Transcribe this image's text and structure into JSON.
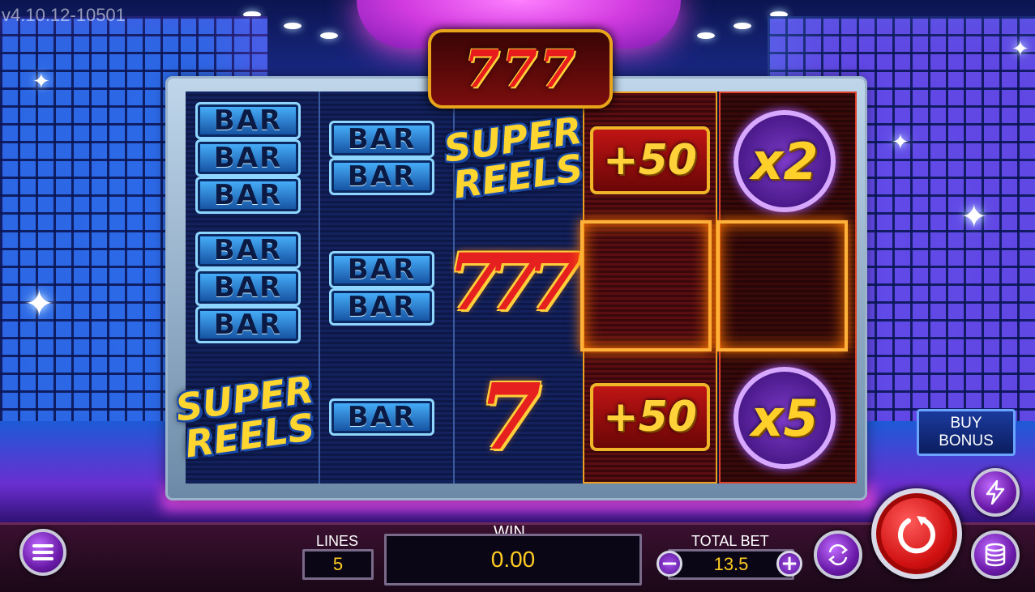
{
  "version": "v4.10.12-10501",
  "logo_text": "777",
  "reels": {
    "bar_label": "BAR",
    "super_reels": [
      "SUPER",
      "REELS"
    ],
    "seven_symbol": "7",
    "triple_seven": "777",
    "bonus_values": {
      "plus_top": "+50",
      "plus_bottom": "+50",
      "mult_top": "x2",
      "mult_bottom": "x5"
    }
  },
  "buy_bonus": {
    "line1": "BUY",
    "line2": "BONUS"
  },
  "bottom": {
    "lines_label": "LINES",
    "lines_value": "5",
    "win_label": "WIN",
    "win_value": "0.00",
    "total_bet_label": "TOTAL BET",
    "total_bet_value": "13.5",
    "minus": "−",
    "plus": "+"
  },
  "icons": {
    "menu": "menu-icon",
    "autoplay": "autoplay-icon",
    "turbo": "lightning-icon",
    "spin": "spin-icon",
    "coins": "coins-icon"
  }
}
